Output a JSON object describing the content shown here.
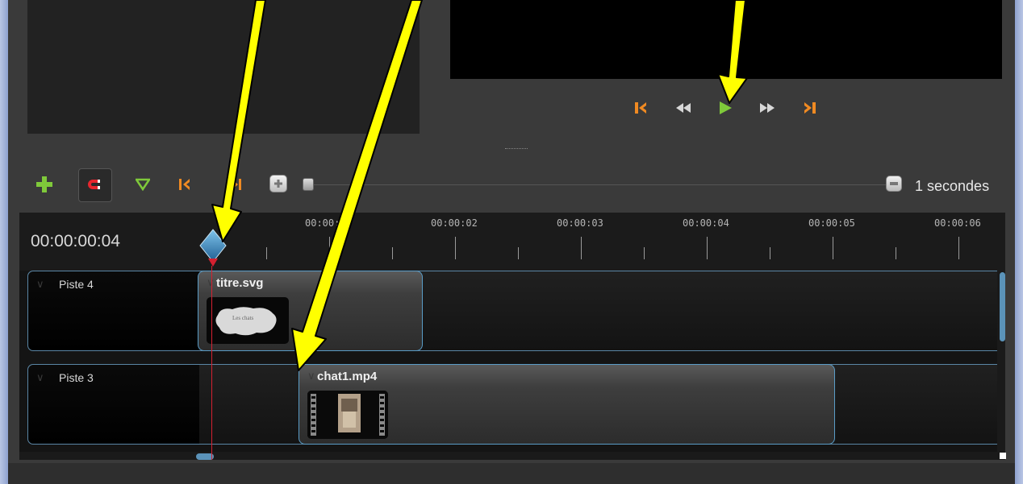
{
  "toolbar": {
    "icons": [
      "add-track-icon",
      "magnet-icon",
      "add-marker-icon",
      "previous-marker-icon",
      "next-marker-icon",
      "zoom-in-icon",
      "zoom-out-icon"
    ],
    "zoom_label": "1 secondes",
    "zoom_level": 0.0
  },
  "playback": {
    "icons": [
      "jump-start-icon",
      "rewind-icon",
      "play-icon",
      "fast-forward-icon",
      "jump-end-icon"
    ]
  },
  "timeline": {
    "timecode": "00:00:00:04",
    "ruler_labels": [
      "00:00:0",
      "00:00:02",
      "00:00:03",
      "00:00:04",
      "00:00:05",
      "00:00:06"
    ]
  },
  "tracks": [
    {
      "name": "Piste 4",
      "clip": {
        "name": "titre.svg",
        "thumb_text": "Les chats"
      }
    },
    {
      "name": "Piste 3",
      "clip": {
        "name": "chat1.mp4"
      }
    }
  ],
  "colors": {
    "accent_green": "#7fc93a",
    "accent_orange": "#f08a22",
    "playhead_red": "#d52030",
    "clip_border": "#5a9cc6",
    "annotation_arrow": "#ffff00"
  }
}
